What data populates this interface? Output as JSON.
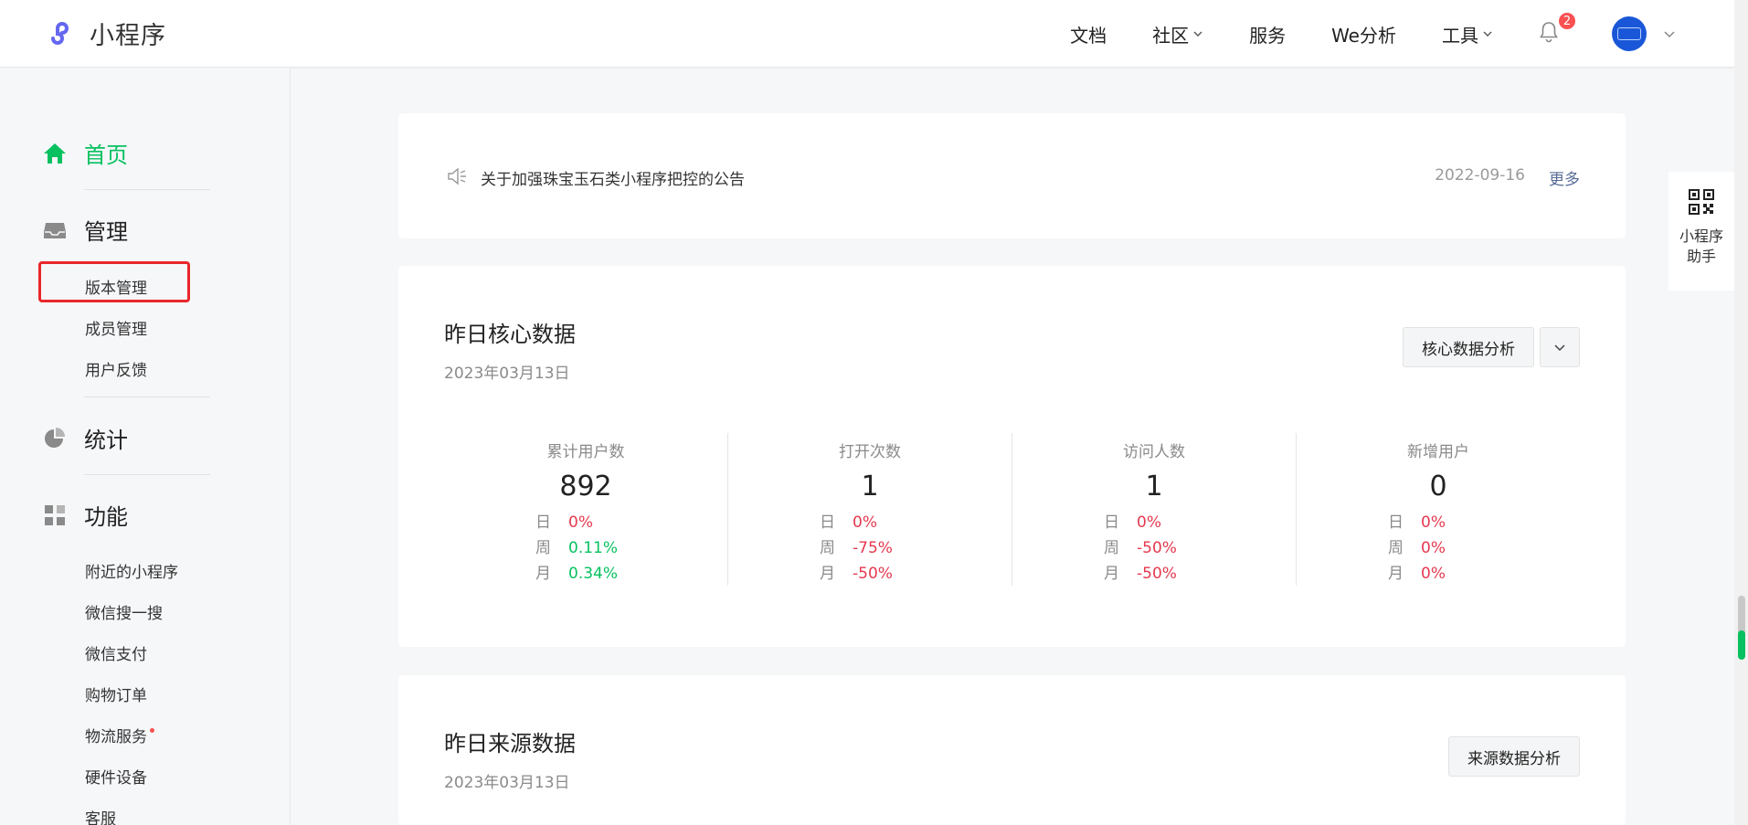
{
  "header": {
    "logo_text": "小程序",
    "nav": [
      {
        "label": "文档",
        "has_dropdown": false
      },
      {
        "label": "社区",
        "has_dropdown": true
      },
      {
        "label": "服务",
        "has_dropdown": false
      },
      {
        "label": "We分析",
        "has_dropdown": false
      },
      {
        "label": "工具",
        "has_dropdown": true
      }
    ],
    "notification_count": "2"
  },
  "sidebar": {
    "home": "首页",
    "manage": "管理",
    "manage_items": [
      "版本管理",
      "成员管理",
      "用户反馈"
    ],
    "stats": "统计",
    "features": "功能",
    "feature_items": [
      "附近的小程序",
      "微信搜一搜",
      "微信支付",
      "购物订单",
      "物流服务",
      "硬件设备",
      "客服"
    ]
  },
  "notice": {
    "text": "关于加强珠宝玉石类小程序把控的公告",
    "date": "2022-09-16",
    "more": "更多"
  },
  "core": {
    "title": "昨日核心数据",
    "date": "2023年03月13日",
    "analysis_button": "核心数据分析",
    "row_labels": {
      "day": "日",
      "week": "周",
      "month": "月"
    },
    "metrics": [
      {
        "label": "累计用户数",
        "value": "892",
        "day": "0%",
        "week": "0.11%",
        "month": "0.34%"
      },
      {
        "label": "打开次数",
        "value": "1",
        "day": "0%",
        "week": "-75%",
        "month": "-50%"
      },
      {
        "label": "访问人数",
        "value": "1",
        "day": "0%",
        "week": "-50%",
        "month": "-50%"
      },
      {
        "label": "新增用户",
        "value": "0",
        "day": "0%",
        "week": "0%",
        "month": "0%"
      }
    ]
  },
  "source": {
    "title": "昨日来源数据",
    "date": "2023年03月13日",
    "analysis_button": "来源数据分析"
  },
  "helper": {
    "line1": "小程序",
    "line2": "助手"
  },
  "colors": {
    "accent_green": "#07c160",
    "negative_red": "#e5394f",
    "link_blue": "#576b95",
    "badge_red": "#fa5151",
    "highlight_red": "#e8272a"
  }
}
